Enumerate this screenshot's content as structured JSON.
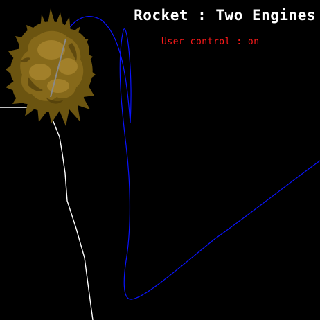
{
  "hud": {
    "title": "Rocket : Two Engines",
    "status": "User control : on"
  },
  "colors": {
    "background": "#000000",
    "title_text": "#ffffff",
    "status_text": "#ff1a1a",
    "trajectory": "#0a14ff",
    "terrain": "#ffffff",
    "explosion_outer": "#6b5410",
    "explosion_mid": "#86691a",
    "explosion_inner": "#a2802a"
  },
  "icons": {
    "explosion": "explosion-sprite",
    "rocket": "rocket-wreck"
  }
}
